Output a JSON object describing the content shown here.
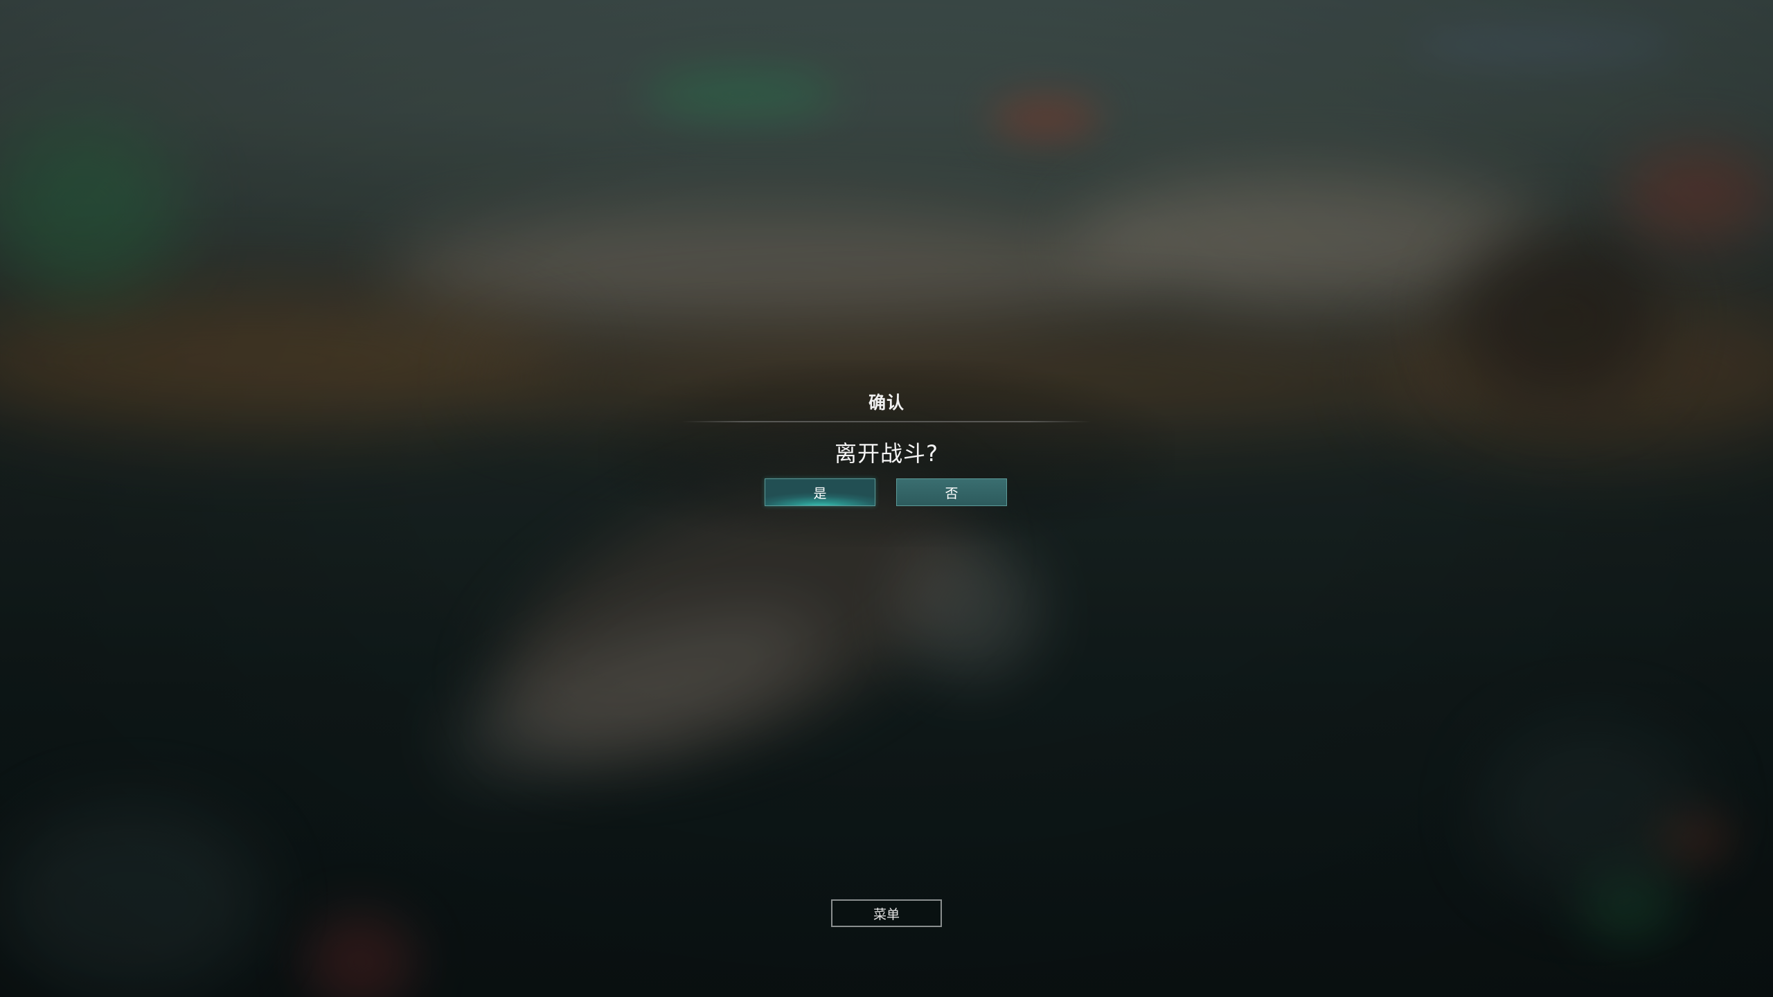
{
  "dialog": {
    "title": "确认",
    "message": "离开战斗?",
    "yes_label": "是",
    "no_label": "否"
  },
  "menu": {
    "label": "菜单"
  },
  "colors": {
    "button_accent": "#2a8d88",
    "button_border": "#5c9a98",
    "menu_border": "#8a8f8f"
  }
}
